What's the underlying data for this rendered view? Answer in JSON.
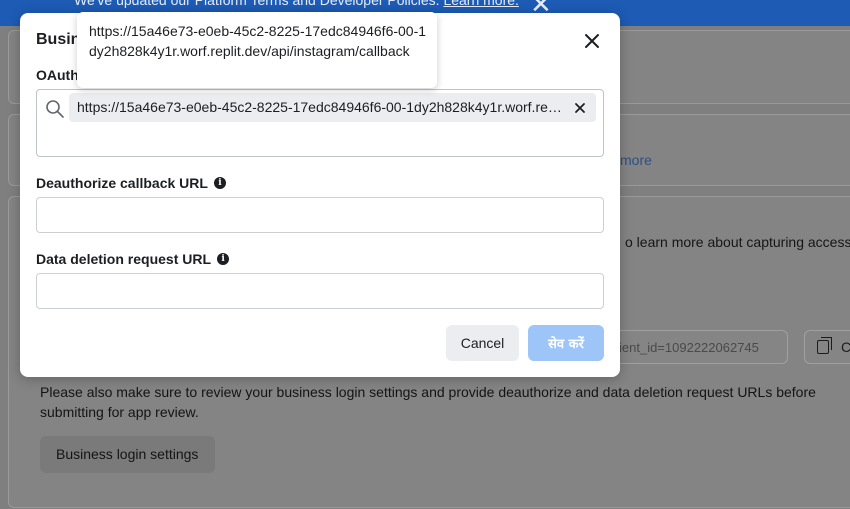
{
  "background": {
    "banner_text": "We've updated our Platform Terms and Developer Policies.",
    "banner_link": "Learn more.",
    "more_link": "more",
    "learn_text": "o learn more about capturing access",
    "client_id_value": "ient_id=1092222062745",
    "copy_label": "C",
    "paragraph": "Please also make sure to review your business login settings and provide deauthorize and data deletion request URLs before submitting for app review.",
    "settings_button": "Business login settings"
  },
  "modal": {
    "title": "Business login settings",
    "oauth_label": "OAuth redirect URIs",
    "oauth_token": "https://15a46e73-e0eb-45c2-8225-17edc84946f6-00-1dy2h828k4y1r.worf.replit.dev/api/instagram/callback",
    "deauth_label": "Deauthorize callback URL",
    "deauth_value": "",
    "deletion_label": "Data deletion request URL",
    "deletion_value": "",
    "cancel_label": "Cancel",
    "save_label": "सेव करें"
  },
  "tooltip": {
    "text": "https://15a46e73-e0eb-45c2-8225-17edc84946f6-00-1dy2h828k4y1r.worf.replit.dev/api/instagram/callback"
  },
  "colors": {
    "overlay": "#7f7f7f",
    "banner": "#1d5bb5",
    "save_disabled": "#9ec5f7",
    "token_bg": "#ebedf0"
  },
  "icons": [
    "search-icon",
    "close-icon",
    "info-icon",
    "copy-icon"
  ]
}
